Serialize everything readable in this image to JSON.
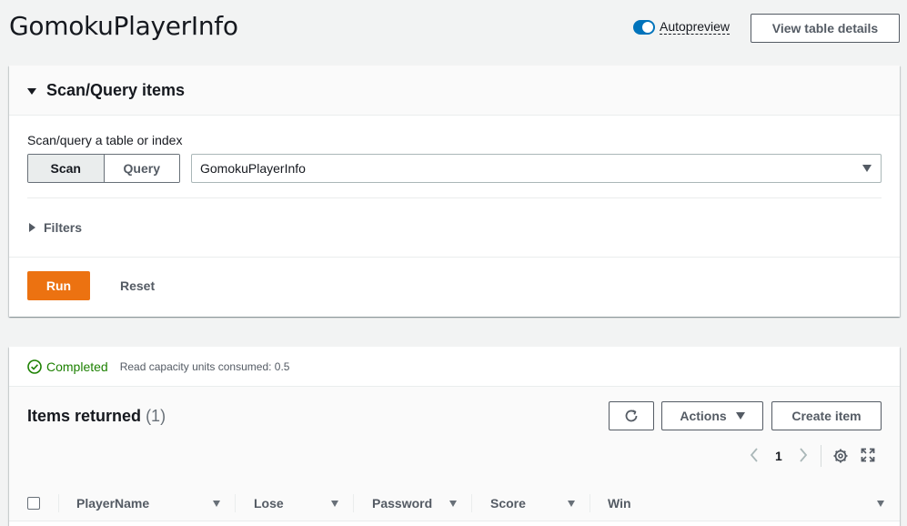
{
  "header": {
    "title": "GomokuPlayerInfo",
    "autopreview_label": "Autopreview",
    "autopreview_on": true,
    "view_details_label": "View table details"
  },
  "scan_panel": {
    "title": "Scan/Query items",
    "field_label": "Scan/query a table or index",
    "mode_options": [
      "Scan",
      "Query"
    ],
    "selected_mode": "Scan",
    "table_select_value": "GomokuPlayerInfo",
    "filters_label": "Filters",
    "run_label": "Run",
    "reset_label": "Reset"
  },
  "results": {
    "status": "Completed",
    "capacity_text": "Read capacity units consumed: 0.5",
    "title": "Items returned",
    "count": "(1)",
    "actions_label": "Actions",
    "create_label": "Create item",
    "current_page": "1",
    "columns": [
      "PlayerName",
      "Lose",
      "Password",
      "Score",
      "Win"
    ]
  },
  "colors": {
    "accent": "#ec7211",
    "toggle": "#0073bb",
    "success": "#1d8102"
  }
}
